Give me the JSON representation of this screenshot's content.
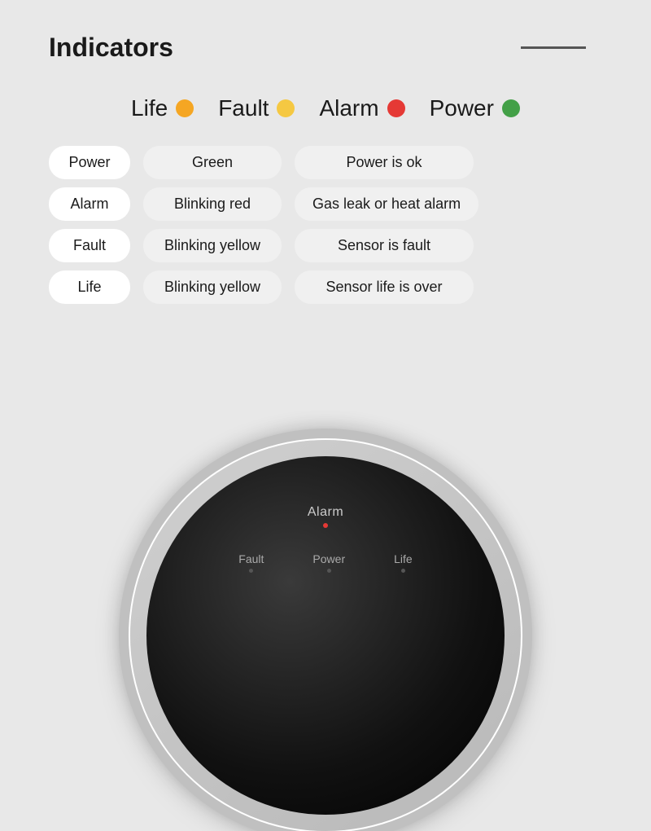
{
  "header": {
    "title": "Indicators",
    "line": true
  },
  "legend": [
    {
      "label": "Life",
      "dot_color": "orange",
      "dot_class": "dot-orange"
    },
    {
      "label": "Fault",
      "dot_color": "yellow",
      "dot_class": "dot-yellow"
    },
    {
      "label": "Alarm",
      "dot_color": "red",
      "dot_class": "dot-red"
    },
    {
      "label": "Power",
      "dot_color": "green",
      "dot_class": "dot-green"
    }
  ],
  "table": {
    "rows": [
      {
        "col1": "Power",
        "col2": "Green",
        "col3": "Power is ok"
      },
      {
        "col1": "Alarm",
        "col2": "Blinking red",
        "col3": "Gas leak or heat alarm"
      },
      {
        "col1": "Fault",
        "col2": "Blinking yellow",
        "col3": "Sensor is fault"
      },
      {
        "col1": "Life",
        "col2": "Blinking yellow",
        "col3": "Sensor life is over"
      }
    ]
  },
  "device": {
    "alarm_label": "Alarm",
    "fault_label": "Fault",
    "power_label": "Power",
    "life_label": "Life"
  }
}
